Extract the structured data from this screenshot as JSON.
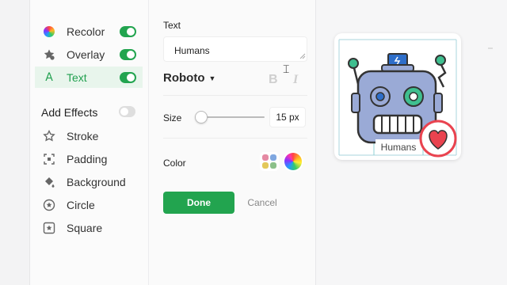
{
  "sidebar": {
    "items": [
      {
        "label": "Recolor",
        "icon": "recolor-wheel-icon",
        "toggle": "on"
      },
      {
        "label": "Overlay",
        "icon": "overlay-star-icon",
        "toggle": "on"
      },
      {
        "label": "Text",
        "icon": "text-a-icon",
        "toggle": "on",
        "active": true
      }
    ],
    "effects_title": "Add Effects",
    "effects_toggle": "off",
    "effects": [
      {
        "label": "Stroke",
        "icon": "star-outline-icon"
      },
      {
        "label": "Padding",
        "icon": "padding-expand-icon"
      },
      {
        "label": "Background",
        "icon": "paint-bucket-icon"
      },
      {
        "label": "Circle",
        "icon": "circle-star-icon"
      },
      {
        "label": "Square",
        "icon": "square-star-icon"
      }
    ]
  },
  "panel": {
    "text_label": "Text",
    "text_value": "Humans",
    "font_name": "Roboto",
    "bold_label": "B",
    "italic_label": "I",
    "size_label": "Size",
    "size_value": "15 px",
    "size_slider_fraction": 0.05,
    "color_label": "Color",
    "done_label": "Done",
    "cancel_label": "Cancel"
  },
  "preview": {
    "caption": "Humans"
  },
  "colors": {
    "accent": "#22a44f",
    "robot_body": "#9aaad6",
    "robot_accent": "#2e6ec9",
    "heart": "#e9434f"
  }
}
